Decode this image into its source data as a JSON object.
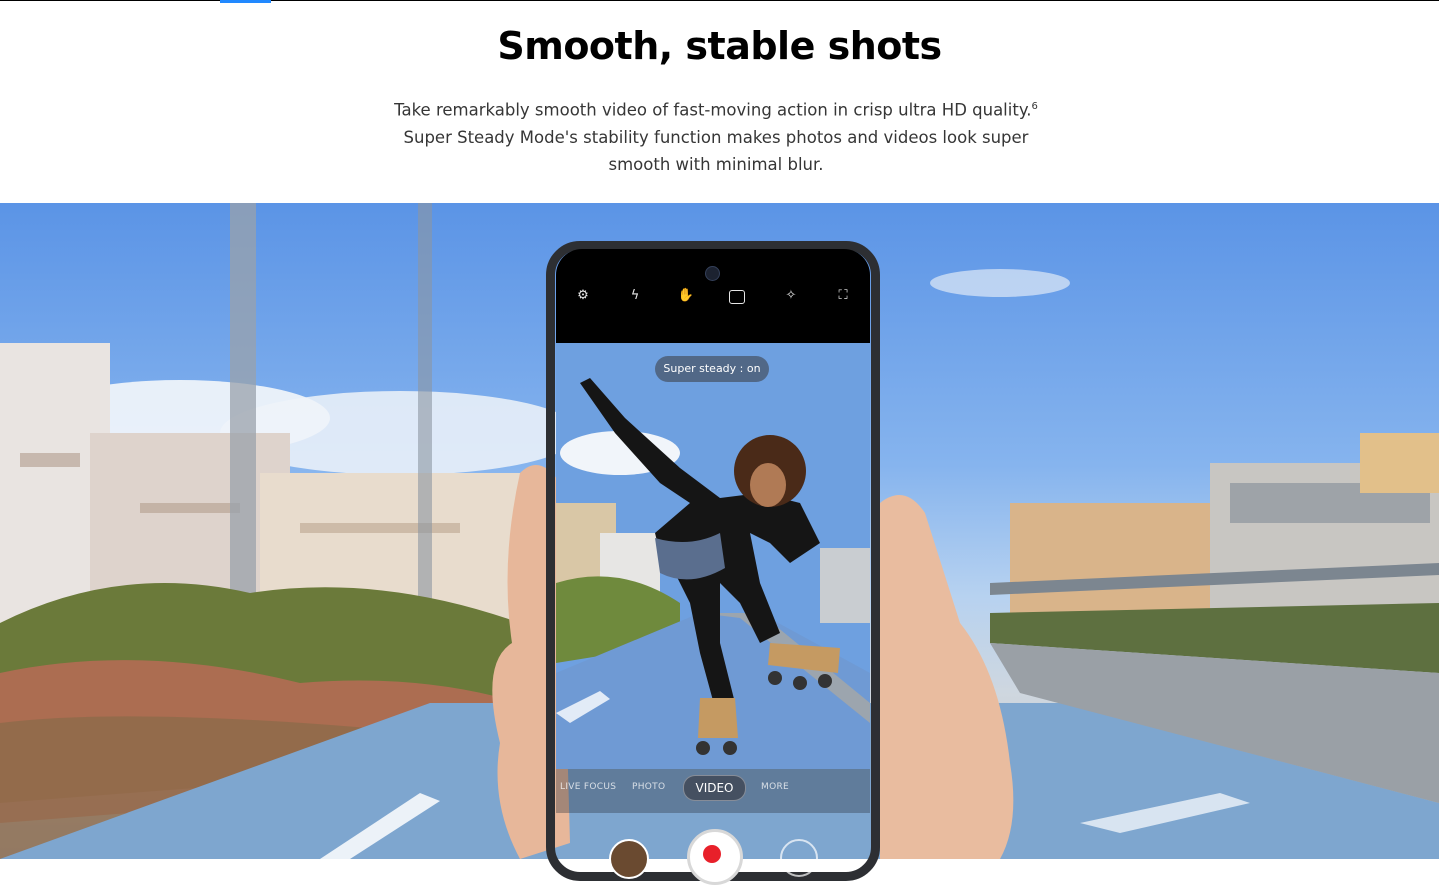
{
  "section": {
    "headline": "Smooth, stable shots",
    "description_text": "Take remarkably smooth video of fast-moving action in crisp ultra HD quality.",
    "footnote": "6",
    "description_rest": " Super Steady Mode's stability function makes photos and videos look super smooth with minimal blur."
  },
  "camera_ui": {
    "status_pill": "Super steady : on",
    "modes": [
      "LIVE FOCUS",
      "PHOTO",
      "VIDEO",
      "MORE"
    ],
    "active_mode": "VIDEO",
    "top_icons": [
      "settings-icon",
      "flash-off-icon",
      "super-steady-icon",
      "aspect-ratio-icon",
      "effects-icon",
      "zoom-icon"
    ]
  },
  "colors": {
    "accent": "#2189ff",
    "record": "#e8202a",
    "steady_active": "#f0c020"
  }
}
